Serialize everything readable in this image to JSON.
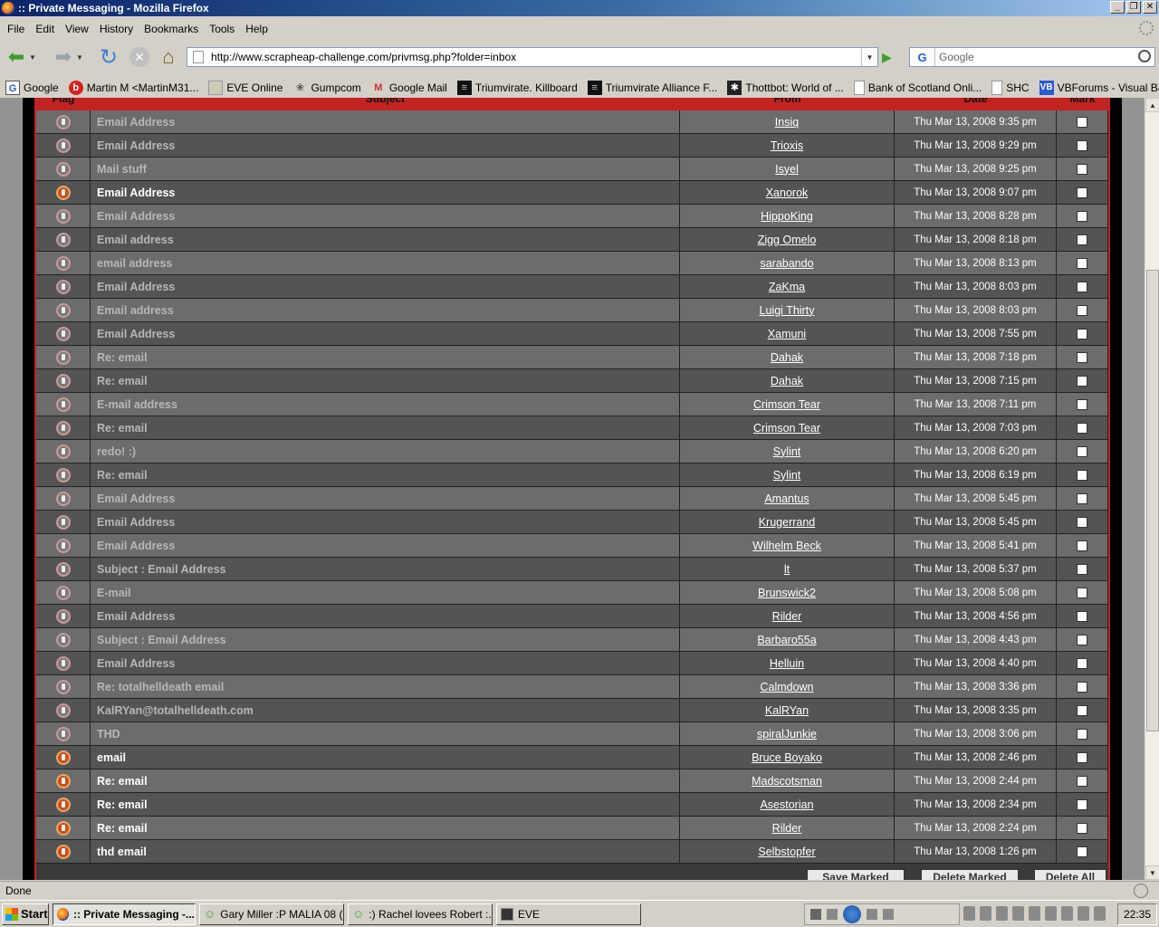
{
  "window": {
    "title": ":: Private Messaging - Mozilla Firefox",
    "min": "_",
    "restore": "❐",
    "close": "✕"
  },
  "menu": [
    "File",
    "Edit",
    "View",
    "History",
    "Bookmarks",
    "Tools",
    "Help"
  ],
  "nav": {
    "url": "http://www.scrapheap-challenge.com/privmsg.php?folder=inbox",
    "search_placeholder": "Google",
    "search_engine": "G"
  },
  "bookmarks": [
    {
      "label": "Google",
      "icon": "google-icon"
    },
    {
      "label": "Martin M <MartinM31...",
      "icon": "bebo-icon"
    },
    {
      "label": "EVE Online",
      "icon": "eve-icon"
    },
    {
      "label": "Gumpcom",
      "icon": "gumpcom-icon"
    },
    {
      "label": "Google Mail",
      "icon": "gmail-icon"
    },
    {
      "label": "Triumvirate. Killboard",
      "icon": "triumvirate-icon"
    },
    {
      "label": "Triumvirate Alliance F...",
      "icon": "triumvirate-icon"
    },
    {
      "label": "Thottbot: World of ...",
      "icon": "thottbot-icon"
    },
    {
      "label": "Bank of Scotland Onli...",
      "icon": "page-icon"
    },
    {
      "label": "SHC",
      "icon": "page-icon"
    },
    {
      "label": "VBForums - Visual Ba...",
      "icon": "vbforums-icon"
    }
  ],
  "table": {
    "headers": {
      "flag": "Flag",
      "subject": "Subject",
      "from": "From",
      "date": "Date",
      "mark": "Mark"
    },
    "rows": [
      {
        "subject": "Email Address",
        "from": "Insiq",
        "date": "Thu Mar 13, 2008 9:35 pm",
        "unread": false
      },
      {
        "subject": "Email Address",
        "from": "Trioxis",
        "date": "Thu Mar 13, 2008 9:29 pm",
        "unread": false
      },
      {
        "subject": "Mail stuff",
        "from": "Isyel",
        "date": "Thu Mar 13, 2008 9:25 pm",
        "unread": false
      },
      {
        "subject": "Email Address",
        "from": "Xanorok",
        "date": "Thu Mar 13, 2008 9:07 pm",
        "unread": true
      },
      {
        "subject": "Email Address",
        "from": "HippoKing",
        "date": "Thu Mar 13, 2008 8:28 pm",
        "unread": false
      },
      {
        "subject": "Email address",
        "from": "Zigg Omelo",
        "date": "Thu Mar 13, 2008 8:18 pm",
        "unread": false
      },
      {
        "subject": "email address",
        "from": "sarabando",
        "date": "Thu Mar 13, 2008 8:13 pm",
        "unread": false
      },
      {
        "subject": "Email Address",
        "from": "ZaKma",
        "date": "Thu Mar 13, 2008 8:03 pm",
        "unread": false
      },
      {
        "subject": "Email address",
        "from": "Luigi Thirty",
        "date": "Thu Mar 13, 2008 8:03 pm",
        "unread": false
      },
      {
        "subject": "Email Address",
        "from": "Xamuni",
        "date": "Thu Mar 13, 2008 7:55 pm",
        "unread": false
      },
      {
        "subject": "Re: email",
        "from": "Dahak",
        "date": "Thu Mar 13, 2008 7:18 pm",
        "unread": false
      },
      {
        "subject": "Re: email",
        "from": "Dahak",
        "date": "Thu Mar 13, 2008 7:15 pm",
        "unread": false
      },
      {
        "subject": "E-mail address",
        "from": "Crimson Tear",
        "date": "Thu Mar 13, 2008 7:11 pm",
        "unread": false
      },
      {
        "subject": "Re: email",
        "from": "Crimson Tear",
        "date": "Thu Mar 13, 2008 7:03 pm",
        "unread": false
      },
      {
        "subject": "redo! :)",
        "from": "Sylint",
        "date": "Thu Mar 13, 2008 6:20 pm",
        "unread": false
      },
      {
        "subject": "Re: email",
        "from": "Sylint",
        "date": "Thu Mar 13, 2008 6:19 pm",
        "unread": false
      },
      {
        "subject": "Email Address",
        "from": "Amantus",
        "date": "Thu Mar 13, 2008 5:45 pm",
        "unread": false
      },
      {
        "subject": "Email Address",
        "from": "Krugerrand",
        "date": "Thu Mar 13, 2008 5:45 pm",
        "unread": false
      },
      {
        "subject": "Email Address",
        "from": "Wilhelm Beck",
        "date": "Thu Mar 13, 2008 5:41 pm",
        "unread": false
      },
      {
        "subject": "Subject : Email Address",
        "from": "lt",
        "date": "Thu Mar 13, 2008 5:37 pm",
        "unread": false
      },
      {
        "subject": "E-mail",
        "from": "Brunswick2",
        "date": "Thu Mar 13, 2008 5:08 pm",
        "unread": false
      },
      {
        "subject": "Email Address",
        "from": "Rilder",
        "date": "Thu Mar 13, 2008 4:56 pm",
        "unread": false
      },
      {
        "subject": "Subject : Email Address",
        "from": "Barbaro55a",
        "date": "Thu Mar 13, 2008 4:43 pm",
        "unread": false
      },
      {
        "subject": "Email Address",
        "from": "Helluin",
        "date": "Thu Mar 13, 2008 4:40 pm",
        "unread": false
      },
      {
        "subject": "Re: totalhelldeath email",
        "from": "Calmdown",
        "date": "Thu Mar 13, 2008 3:36 pm",
        "unread": false
      },
      {
        "subject": "KalRYan@totalhelldeath.com",
        "from": "KalRYan",
        "date": "Thu Mar 13, 2008 3:35 pm",
        "unread": false
      },
      {
        "subject": "THD",
        "from": "spiralJunkie",
        "date": "Thu Mar 13, 2008 3:06 pm",
        "unread": false
      },
      {
        "subject": "email",
        "from": "Bruce Boyako",
        "date": "Thu Mar 13, 2008 2:46 pm",
        "unread": true
      },
      {
        "subject": "Re: email",
        "from": "Madscotsman",
        "date": "Thu Mar 13, 2008 2:44 pm",
        "unread": true
      },
      {
        "subject": "Re: email",
        "from": "Asestorian",
        "date": "Thu Mar 13, 2008 2:34 pm",
        "unread": true
      },
      {
        "subject": "Re: email",
        "from": "Rilder",
        "date": "Thu Mar 13, 2008 2:24 pm",
        "unread": true
      },
      {
        "subject": "thd email",
        "from": "Selbstopfer",
        "date": "Thu Mar 13, 2008 1:26 pm",
        "unread": true
      }
    ]
  },
  "actions": {
    "save_marked": "Save Marked",
    "delete_marked": "Delete Marked",
    "delete_all": "Delete All"
  },
  "status": {
    "text": "Done"
  },
  "taskbar": {
    "start": "Start",
    "tasks": [
      {
        "label": ":: Private Messaging -...",
        "icon": "firefox-icon",
        "active": true
      },
      {
        "label": "Gary Miller :P MALIA 08 (...",
        "icon": "msn-icon",
        "active": false
      },
      {
        "label": ":) Rachel lovees Robert :...",
        "icon": "msn-icon",
        "active": false
      },
      {
        "label": "EVE",
        "icon": "eve-icon",
        "active": false
      }
    ],
    "clock": "22:35"
  },
  "colors": {
    "table_border": "#c42323",
    "row_light": "#6c6c6c",
    "row_dark": "#545454",
    "unread_text": "#ffffff",
    "read_text": "#b7b7b7"
  }
}
